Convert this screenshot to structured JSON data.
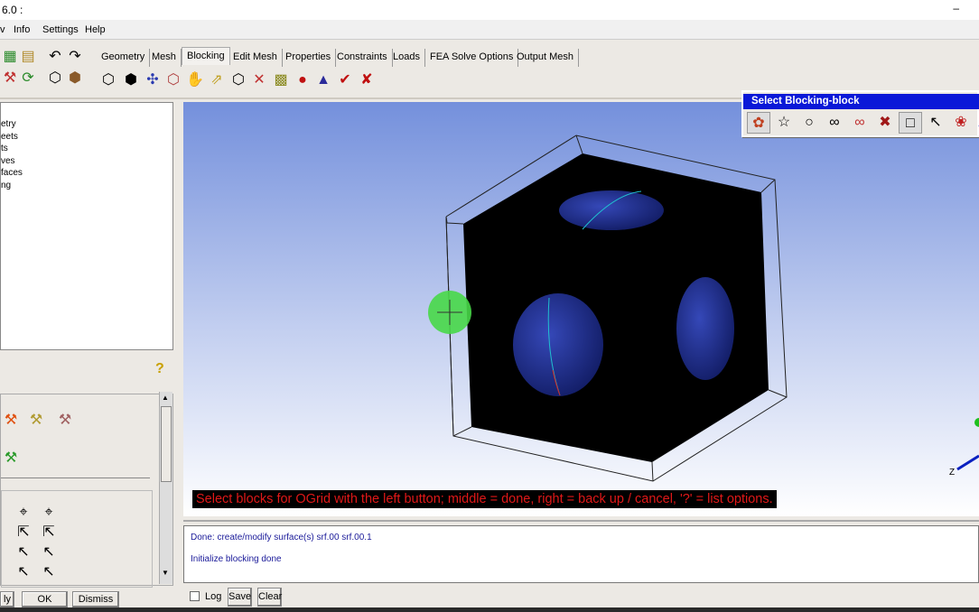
{
  "window": {
    "title": "6.0 :",
    "minimize": "–"
  },
  "menu": [
    "Info",
    "Settings",
    "Help"
  ],
  "tabs": [
    {
      "label": "Geometry"
    },
    {
      "label": "Mesh"
    },
    {
      "label": "Blocking",
      "active": true
    },
    {
      "label": "Edit Mesh"
    },
    {
      "label": "Properties"
    },
    {
      "label": "Constraints"
    },
    {
      "label": "Loads"
    },
    {
      "label": "FEA Solve Options"
    },
    {
      "label": "Output Mesh"
    }
  ],
  "tree": [
    "etry",
    "eets",
    "ts",
    "ves",
    "faces",
    "ng"
  ],
  "panel": {
    "help_icon": "?",
    "buttons": {
      "apply": "ly",
      "ok": "OK",
      "dismiss": "Dismiss"
    }
  },
  "select_dialog": {
    "title": "Select Blocking-block"
  },
  "prompt": "Select blocks for OGrid with the left button; middle = done, right = back up / cancel, '?' = list options.",
  "messages": [
    "Done: create/modify surface(s) srf.00 srf.00.1",
    "Initialize blocking done"
  ],
  "msg_controls": {
    "log": "Log",
    "save": "Save",
    "clear": "Clear"
  },
  "axis": {
    "z": "Z"
  },
  "colors": {
    "prompt_text": "#e01818",
    "dialog_title": "#0a18d8",
    "cube": "#000000",
    "hole": "#1e2a80"
  }
}
